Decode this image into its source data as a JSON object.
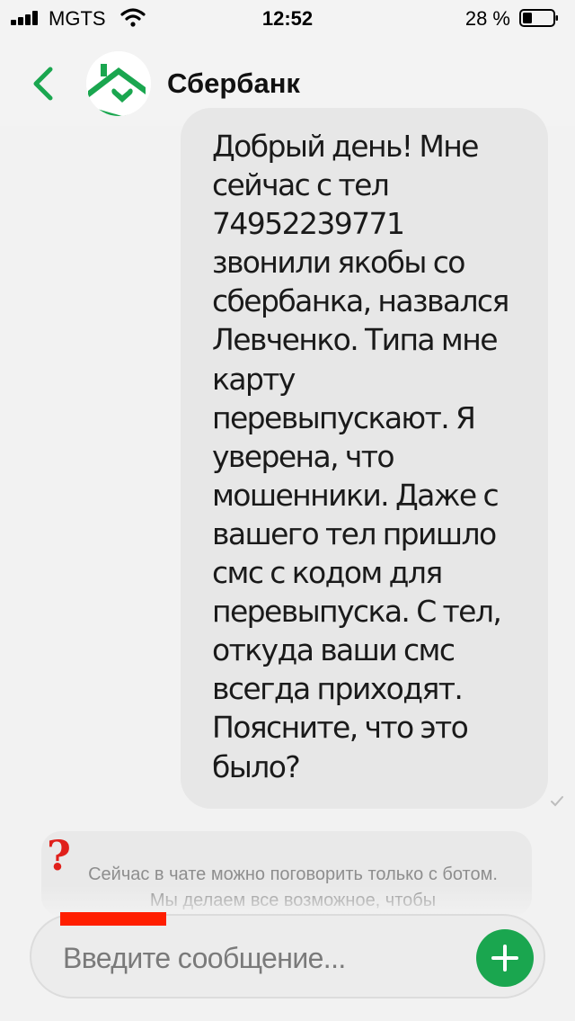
{
  "status_bar": {
    "carrier": "MGTS",
    "time": "12:52",
    "battery": "28 %"
  },
  "header": {
    "contact_name": "Сбербанк"
  },
  "message": {
    "text": "Добрый день! Мне\nсейчас с тел\n74952239771\nзвонили якобы со\nсбербанка, назвался\nЛевченко. Типа мне\nкарту\nперевыпускают. Я\nуверена, что\nмошенники. Даже с\nвашего тел пришло\nсмс с кодом для\nперевыпуска. С тел,\nоткуда ваши смс\nвсегда приходят.\nПоясните, что это\nбыло?"
  },
  "notice": {
    "icon_glyph": "?",
    "text": "Сейчас в чате можно поговорить только с ботом. Мы делаем все возможное, чтобы"
  },
  "composer": {
    "placeholder": "Введите сообщение..."
  },
  "colors": {
    "accent": "#1aa64f",
    "bubble": "#e7e7e7",
    "marker": "#ff1e00"
  }
}
